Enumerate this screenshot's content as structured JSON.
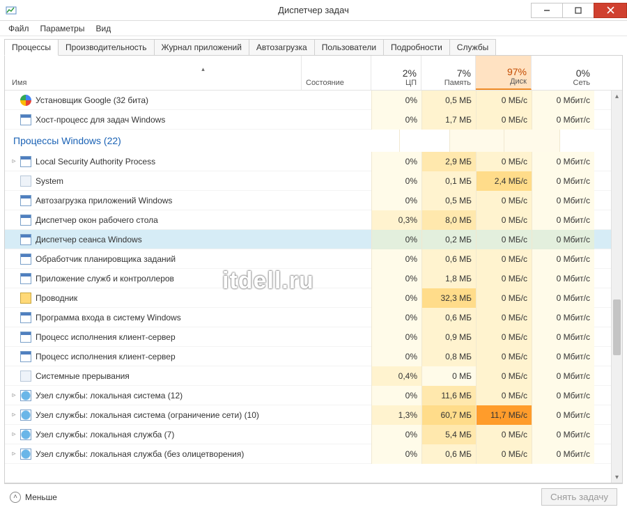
{
  "window": {
    "title": "Диспетчер задач"
  },
  "menu": {
    "file": "Файл",
    "options": "Параметры",
    "view": "Вид"
  },
  "tabs": {
    "processes": "Процессы",
    "performance": "Производительность",
    "app_history": "Журнал приложений",
    "startup": "Автозагрузка",
    "users": "Пользователи",
    "details": "Подробности",
    "services": "Службы"
  },
  "columns": {
    "name": "Имя",
    "status": "Состояние",
    "cpu_pct": "2%",
    "cpu_label": "ЦП",
    "mem_pct": "7%",
    "mem_label": "Память",
    "disk_pct": "97%",
    "disk_label": "Диск",
    "net_pct": "0%",
    "net_label": "Сеть"
  },
  "group_header": "Процессы Windows (22)",
  "rows_top": [
    {
      "name": "Установщик Google (32 бита)",
      "icon": "google",
      "expand": "",
      "cpu": "0%",
      "mem": "0,5 МБ",
      "disk": "0 МБ/с",
      "net": "0 Мбит/с",
      "heat": {
        "cpu": "h0",
        "mem": "h1",
        "disk": "h1",
        "net": "h0"
      }
    },
    {
      "name": "Хост-процесс для задач Windows",
      "icon": "win",
      "expand": "",
      "cpu": "0%",
      "mem": "1,7 МБ",
      "disk": "0 МБ/с",
      "net": "0 Мбит/с",
      "heat": {
        "cpu": "h0",
        "mem": "h1",
        "disk": "h1",
        "net": "h0"
      }
    }
  ],
  "rows": [
    {
      "name": "Local Security Authority Process",
      "icon": "win",
      "expand": "▹",
      "cpu": "0%",
      "mem": "2,9 МБ",
      "disk": "0 МБ/с",
      "net": "0 Мбит/с",
      "heat": {
        "cpu": "h0",
        "mem": "h2",
        "disk": "h1",
        "net": "h0"
      }
    },
    {
      "name": "System",
      "icon": "blank",
      "expand": "",
      "cpu": "0%",
      "mem": "0,1 МБ",
      "disk": "2,4 МБ/с",
      "net": "0 Мбит/с",
      "heat": {
        "cpu": "h0",
        "mem": "h1",
        "disk": "h3",
        "net": "h0"
      }
    },
    {
      "name": "Автозагрузка приложений Windows",
      "icon": "win",
      "expand": "",
      "cpu": "0%",
      "mem": "0,5 МБ",
      "disk": "0 МБ/с",
      "net": "0 Мбит/с",
      "heat": {
        "cpu": "h0",
        "mem": "h1",
        "disk": "h1",
        "net": "h0"
      }
    },
    {
      "name": "Диспетчер окон рабочего стола",
      "icon": "win",
      "expand": "",
      "cpu": "0,3%",
      "mem": "8,0 МБ",
      "disk": "0 МБ/с",
      "net": "0 Мбит/с",
      "heat": {
        "cpu": "h1",
        "mem": "h2",
        "disk": "h1",
        "net": "h0"
      }
    },
    {
      "name": "Диспетчер сеанса  Windows",
      "icon": "win",
      "expand": "",
      "cpu": "0%",
      "mem": "0,2 МБ",
      "disk": "0 МБ/с",
      "net": "0 Мбит/с",
      "heat": {
        "cpu": "h0",
        "mem": "h1",
        "disk": "h1",
        "net": "h0"
      },
      "selected": true
    },
    {
      "name": "Обработчик планировщика заданий",
      "icon": "win",
      "expand": "",
      "cpu": "0%",
      "mem": "0,6 МБ",
      "disk": "0 МБ/с",
      "net": "0 Мбит/с",
      "heat": {
        "cpu": "h0",
        "mem": "h1",
        "disk": "h1",
        "net": "h0"
      }
    },
    {
      "name": "Приложение служб и контроллеров",
      "icon": "win",
      "expand": "",
      "cpu": "0%",
      "mem": "1,8 МБ",
      "disk": "0 МБ/с",
      "net": "0 Мбит/с",
      "heat": {
        "cpu": "h0",
        "mem": "h1",
        "disk": "h1",
        "net": "h0"
      }
    },
    {
      "name": "Проводник",
      "icon": "folder",
      "expand": "",
      "cpu": "0%",
      "mem": "32,3 МБ",
      "disk": "0 МБ/с",
      "net": "0 Мбит/с",
      "heat": {
        "cpu": "h0",
        "mem": "h3",
        "disk": "h1",
        "net": "h0"
      }
    },
    {
      "name": "Программа входа в систему Windows",
      "icon": "win",
      "expand": "",
      "cpu": "0%",
      "mem": "0,6 МБ",
      "disk": "0 МБ/с",
      "net": "0 Мбит/с",
      "heat": {
        "cpu": "h0",
        "mem": "h1",
        "disk": "h1",
        "net": "h0"
      }
    },
    {
      "name": "Процесс исполнения клиент-сервер",
      "icon": "win",
      "expand": "",
      "cpu": "0%",
      "mem": "0,9 МБ",
      "disk": "0 МБ/с",
      "net": "0 Мбит/с",
      "heat": {
        "cpu": "h0",
        "mem": "h1",
        "disk": "h1",
        "net": "h0"
      }
    },
    {
      "name": "Процесс исполнения клиент-сервер",
      "icon": "win",
      "expand": "",
      "cpu": "0%",
      "mem": "0,8 МБ",
      "disk": "0 МБ/с",
      "net": "0 Мбит/с",
      "heat": {
        "cpu": "h0",
        "mem": "h1",
        "disk": "h1",
        "net": "h0"
      }
    },
    {
      "name": "Системные прерывания",
      "icon": "blank",
      "expand": "",
      "cpu": "0,4%",
      "mem": "0 МБ",
      "disk": "0 МБ/с",
      "net": "0 Мбит/с",
      "heat": {
        "cpu": "h1",
        "mem": "h0",
        "disk": "h1",
        "net": "h0"
      }
    },
    {
      "name": "Узел службы: локальная система (12)",
      "icon": "gear",
      "expand": "▹",
      "cpu": "0%",
      "mem": "11,6 МБ",
      "disk": "0 МБ/с",
      "net": "0 Мбит/с",
      "heat": {
        "cpu": "h0",
        "mem": "h2",
        "disk": "h1",
        "net": "h0"
      }
    },
    {
      "name": "Узел службы: локальная система (ограничение сети) (10)",
      "icon": "gear",
      "expand": "▹",
      "cpu": "1,3%",
      "mem": "60,7 МБ",
      "disk": "11,7 МБ/с",
      "net": "0 Мбит/с",
      "heat": {
        "cpu": "h1",
        "mem": "h3",
        "disk": "h5",
        "net": "h0"
      }
    },
    {
      "name": "Узел службы: локальная служба (7)",
      "icon": "gear",
      "expand": "▹",
      "cpu": "0%",
      "mem": "5,4 МБ",
      "disk": "0 МБ/с",
      "net": "0 Мбит/с",
      "heat": {
        "cpu": "h0",
        "mem": "h2",
        "disk": "h1",
        "net": "h0"
      }
    },
    {
      "name": "Узел службы: локальная служба (без олицетворения)",
      "icon": "gear",
      "expand": "▹",
      "cpu": "0%",
      "mem": "0,6 МБ",
      "disk": "0 МБ/с",
      "net": "0 Мбит/с",
      "heat": {
        "cpu": "h0",
        "mem": "h1",
        "disk": "h1",
        "net": "h0"
      }
    }
  ],
  "footer": {
    "fewer": "Меньше",
    "end_task": "Снять задачу"
  },
  "watermark": "itdell.ru"
}
